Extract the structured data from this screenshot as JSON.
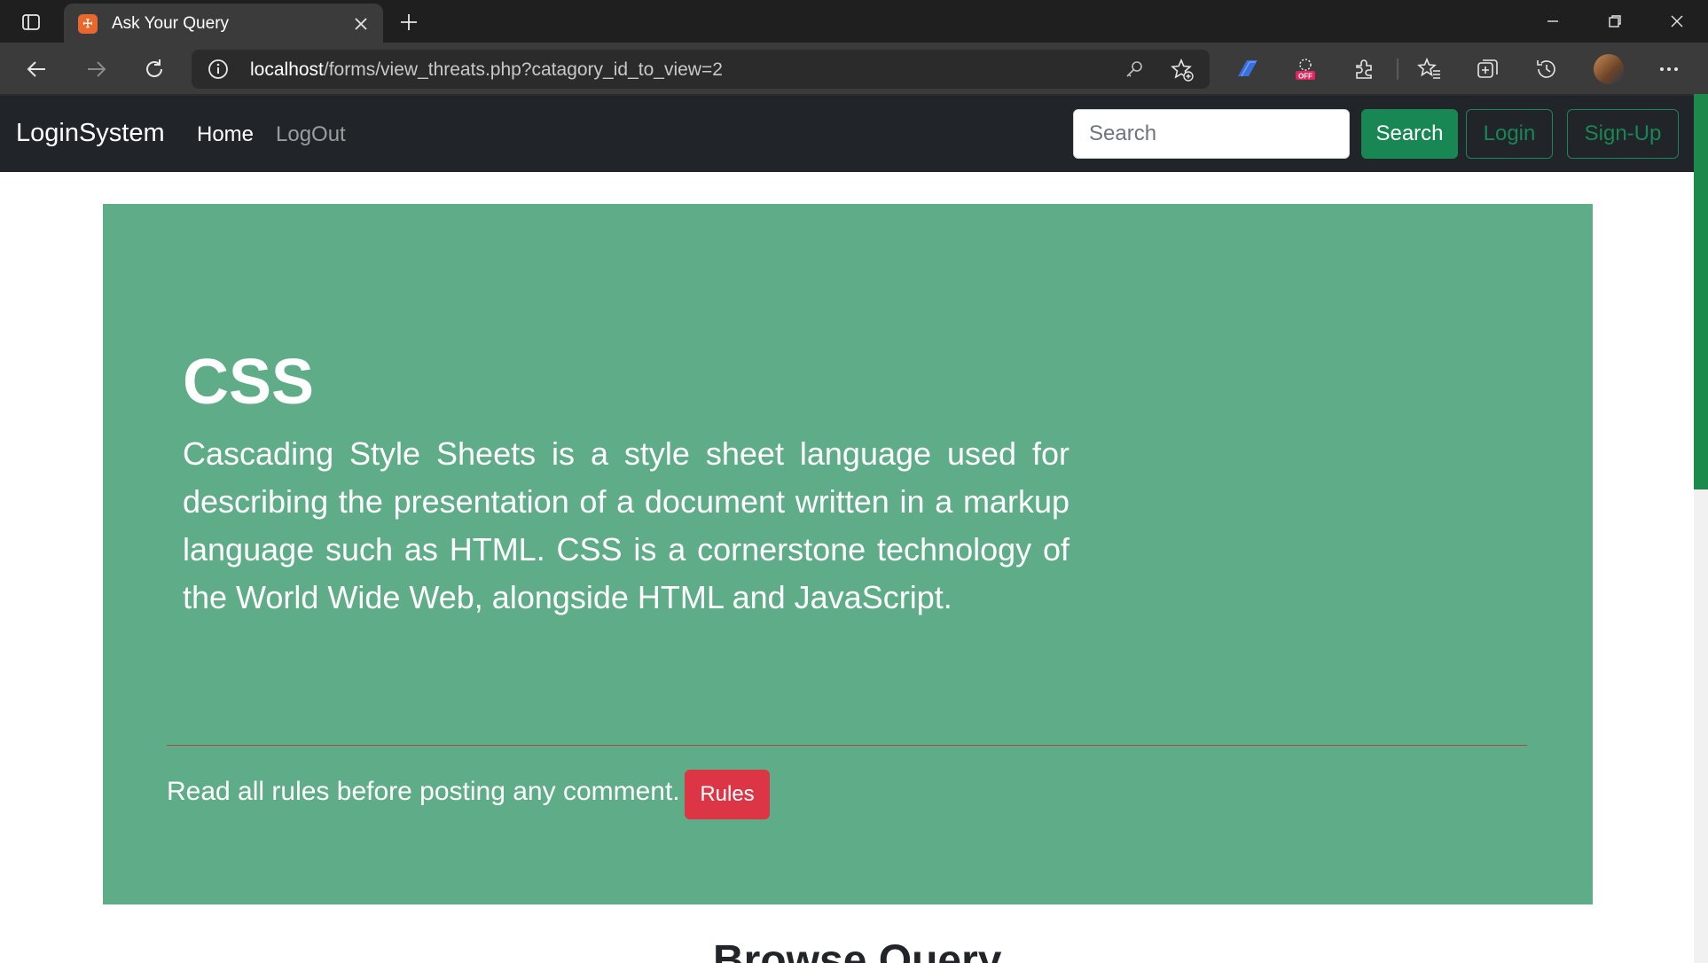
{
  "browser": {
    "tab_title": "Ask Your Query",
    "favicon_text": "☩",
    "url_host": "localhost",
    "url_path": "/forms/view_threats.php?catagory_id_to_view=2"
  },
  "site_nav": {
    "brand": "LoginSystem",
    "links": [
      "Home",
      "LogOut"
    ],
    "search_placeholder": "Search",
    "search_button": "Search",
    "login_button": "Login",
    "signup_button": "Sign-Up"
  },
  "jumbotron": {
    "title": "CSS",
    "description": "Cascading Style Sheets is a style sheet language used for describing the presentation of a document written in a markup language such as HTML. CSS is a cornerstone technology of the World Wide Web, alongside HTML and JavaScript.",
    "rules_text": "Read all rules before posting any comment.",
    "rules_button": "Rules"
  },
  "browse_heading": "Browse Query",
  "colors": {
    "jumbotron_bg": "#5fad88",
    "navbar_bg": "#212529",
    "success": "#198754",
    "danger": "#dc3545"
  }
}
